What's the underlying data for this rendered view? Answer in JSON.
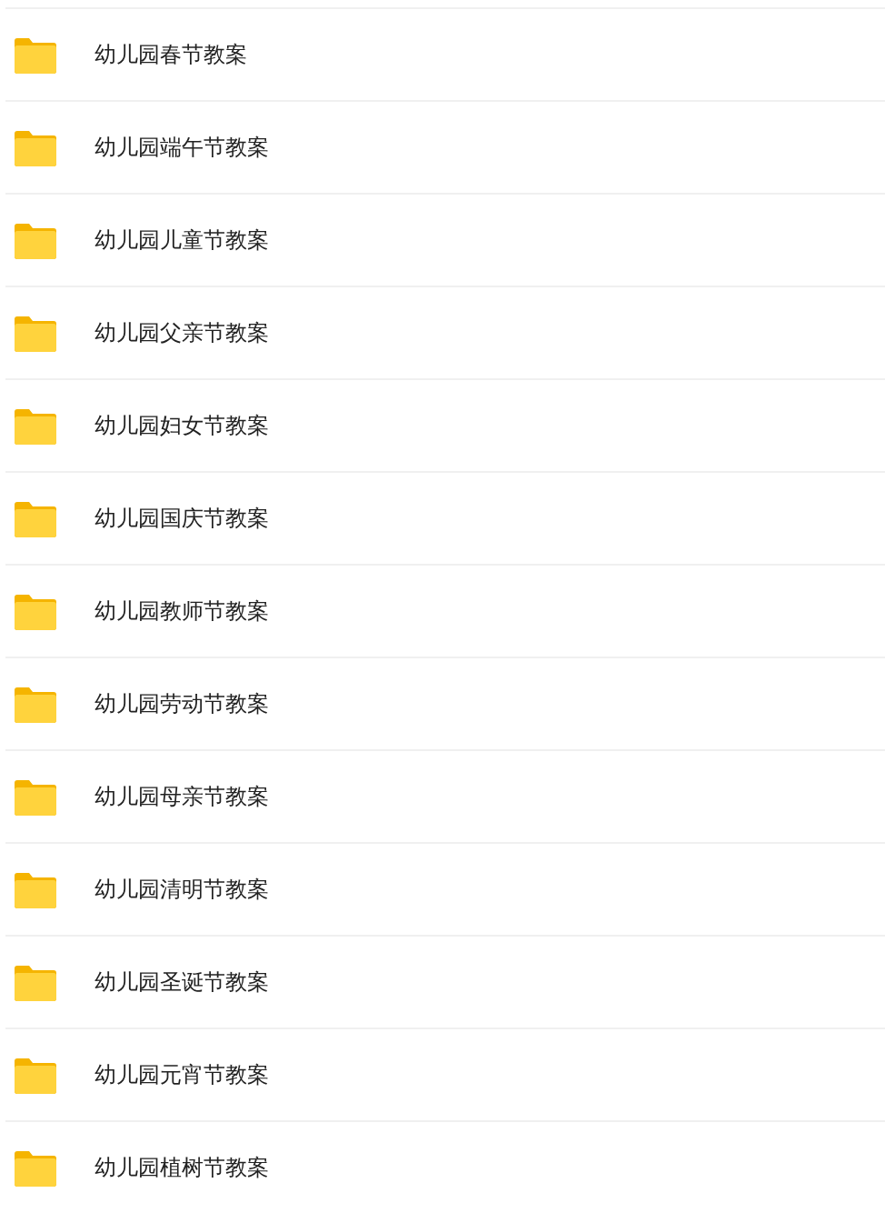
{
  "folders": [
    {
      "name": "幼儿园春节教案"
    },
    {
      "name": "幼儿园端午节教案"
    },
    {
      "name": "幼儿园儿童节教案"
    },
    {
      "name": "幼儿园父亲节教案"
    },
    {
      "name": "幼儿园妇女节教案"
    },
    {
      "name": "幼儿园国庆节教案"
    },
    {
      "name": "幼儿园教师节教案"
    },
    {
      "name": "幼儿园劳动节教案"
    },
    {
      "name": "幼儿园母亲节教案"
    },
    {
      "name": "幼儿园清明节教案"
    },
    {
      "name": "幼儿园圣诞节教案"
    },
    {
      "name": "幼儿园元宵节教案"
    },
    {
      "name": "幼儿园植树节教案"
    }
  ]
}
